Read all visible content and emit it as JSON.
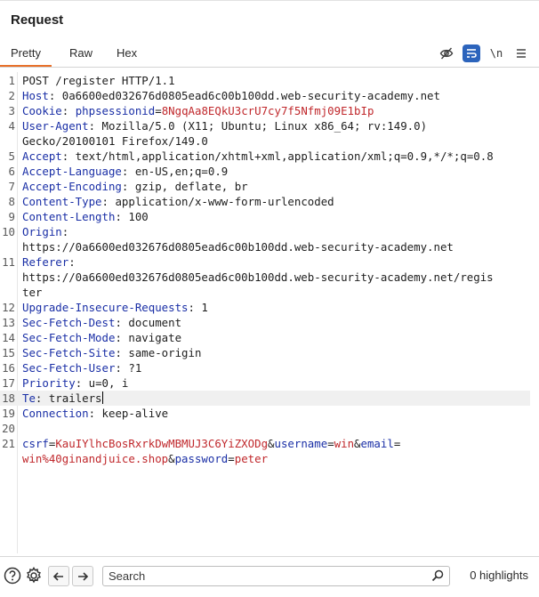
{
  "panel": {
    "title": "Request"
  },
  "tabs": [
    {
      "label": "Pretty"
    },
    {
      "label": "Raw"
    },
    {
      "label": "Hex"
    }
  ],
  "toolbar": {
    "newline_label": "\\n"
  },
  "request_lines": [
    {
      "n": "1",
      "text": "POST /register HTTP/1.1"
    },
    {
      "n": "2",
      "key": "Host",
      "val": ": 0a6600ed032676d0805ead6c00b100dd.web-security-academy.net"
    },
    {
      "n": "3",
      "key": "Cookie",
      "cookie_name": "phpsessionid",
      "cookie_value": "8NgqAa8EQkU3crU7cy7f5Nfmj09E1bIp"
    },
    {
      "n": "4",
      "key": "User-Agent",
      "val": ": Mozilla/5.0 (X11; Ubuntu; Linux x86_64; rv:149.0)"
    },
    {
      "n": "",
      "text": "Gecko/20100101 Firefox/149.0"
    },
    {
      "n": "5",
      "key": "Accept",
      "val": ": text/html,application/xhtml+xml,application/xml;q=0.9,*/*;q=0.8"
    },
    {
      "n": "6",
      "key": "Accept-Language",
      "val": ": en-US,en;q=0.9"
    },
    {
      "n": "7",
      "key": "Accept-Encoding",
      "val": ": gzip, deflate, br"
    },
    {
      "n": "8",
      "key": "Content-Type",
      "val": ": application/x-www-form-urlencoded"
    },
    {
      "n": "9",
      "key": "Content-Length",
      "val": ": 100"
    },
    {
      "n": "10",
      "key": "Origin",
      "val": ":"
    },
    {
      "n": "",
      "text": "https://0a6600ed032676d0805ead6c00b100dd.web-security-academy.net"
    },
    {
      "n": "11",
      "key": "Referer",
      "val": ":"
    },
    {
      "n": "",
      "text": "https://0a6600ed032676d0805ead6c00b100dd.web-security-academy.net/regis"
    },
    {
      "n": "",
      "text": "ter"
    },
    {
      "n": "12",
      "key": "Upgrade-Insecure-Requests",
      "val": ": 1"
    },
    {
      "n": "13",
      "key": "Sec-Fetch-Dest",
      "val": ": document"
    },
    {
      "n": "14",
      "key": "Sec-Fetch-Mode",
      "val": ": navigate"
    },
    {
      "n": "15",
      "key": "Sec-Fetch-Site",
      "val": ": same-origin"
    },
    {
      "n": "16",
      "key": "Sec-Fetch-User",
      "val": ": ?1"
    },
    {
      "n": "17",
      "key": "Priority",
      "val": ": u=0, i"
    },
    {
      "n": "18",
      "key": "Te",
      "val": ": trailers",
      "caret": true
    },
    {
      "n": "19",
      "key": "Connection",
      "val": ": keep-alive"
    },
    {
      "n": "20",
      "text": ""
    },
    {
      "n": "21",
      "params": [
        {
          "k": "csrf",
          "v": "KauIYlhcBosRxrkDwMBMUJ3C6YiZXODg"
        },
        {
          "k": "username",
          "v": "win"
        },
        {
          "k": "email",
          "v": ""
        }
      ]
    },
    {
      "n": "",
      "params_cont": [
        {
          "v": "win%40ginandjuice.shop"
        },
        {
          "k": "password",
          "v": "peter"
        }
      ]
    }
  ],
  "search": {
    "placeholder": "Search"
  },
  "status": {
    "highlights": "0 highlights"
  },
  "colors": {
    "accent": "#e8702a",
    "key": "#1a2fa6",
    "value": "#c0282c",
    "toggle": "#2c64bc"
  }
}
